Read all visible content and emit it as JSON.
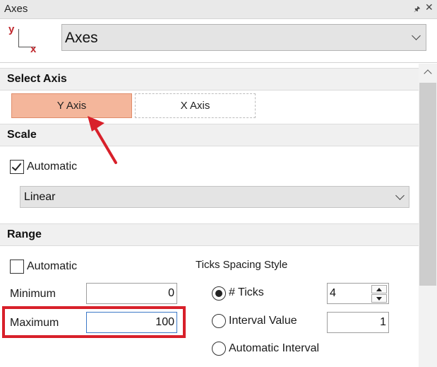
{
  "window": {
    "title": "Axes",
    "pin_icon": "pin-icon",
    "close_icon": "close-icon"
  },
  "header": {
    "icon": "axes-icon",
    "icon_y": "y",
    "icon_x": "x",
    "selected": "Axes"
  },
  "select_axis": {
    "heading": "Select Axis",
    "y_label": "Y Axis",
    "x_label": "X Axis",
    "active": "Y Axis"
  },
  "scale": {
    "heading": "Scale",
    "automatic_label": "Automatic",
    "automatic_checked": true,
    "type": "Linear"
  },
  "range": {
    "heading": "Range",
    "automatic_label": "Automatic",
    "automatic_checked": false,
    "minimum_label": "Minimum",
    "minimum_value": "0",
    "maximum_label": "Maximum",
    "maximum_value": "100"
  },
  "ticks": {
    "heading": "Ticks Spacing Style",
    "options": [
      "# Ticks",
      "Interval Value",
      "Automatic Interval"
    ],
    "selected": "# Ticks",
    "count_value": "4",
    "interval_value": "1"
  },
  "annotations": {
    "highlight_color": "#d8202a",
    "arrow_color": "#d8202a",
    "active_button_color": "#f4b69b"
  }
}
